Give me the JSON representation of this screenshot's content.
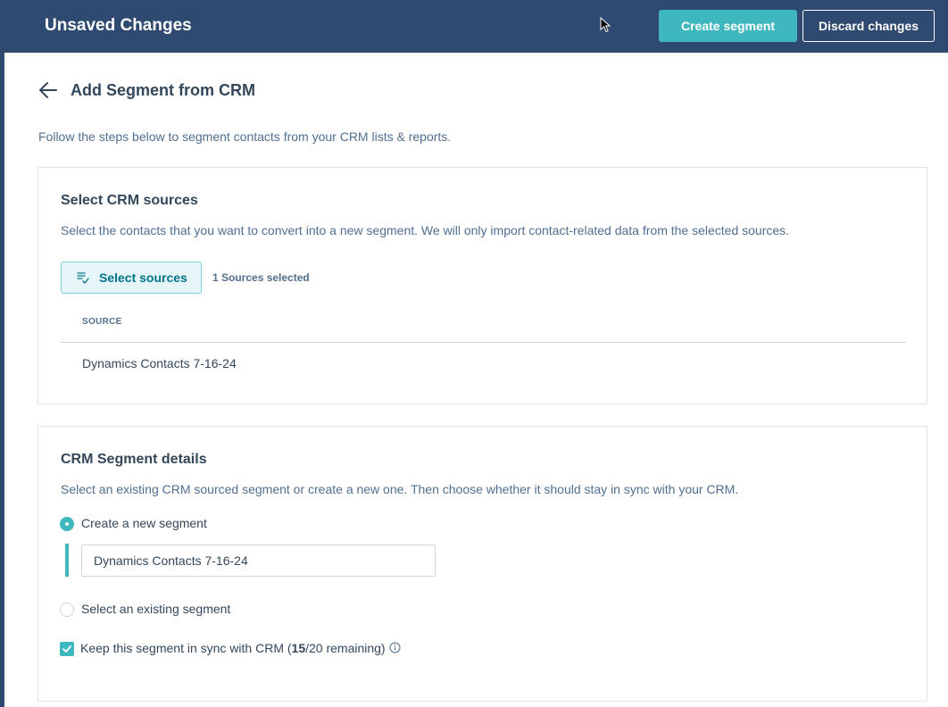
{
  "header": {
    "title": "Unsaved Changes",
    "create_label": "Create segment",
    "discard_label": "Discard changes"
  },
  "page": {
    "title": "Add Segment from CRM",
    "description": "Follow the steps below to segment contacts from your CRM lists & reports."
  },
  "sources_card": {
    "title": "Select CRM sources",
    "description": "Select the contacts that you want to convert into a new segment. We will only import contact-related data from the selected sources.",
    "select_button_label": "Select sources",
    "selected_count": "1 Sources selected",
    "column_header": "SOURCE",
    "rows": [
      "Dynamics Contacts 7-16-24"
    ]
  },
  "details_card": {
    "title": "CRM Segment details",
    "description": "Select an existing CRM sourced segment or create a new one. Then choose whether it should stay in sync with your CRM.",
    "option_new": "Create a new segment",
    "new_segment_value": "Dynamics Contacts 7-16-24",
    "option_existing": "Select an existing segment",
    "sync_prefix": "Keep this segment in sync with CRM (",
    "sync_used": "15",
    "sync_suffix": "/20 remaining)"
  },
  "colors": {
    "topbar": "#2e4a70",
    "accent": "#3fb7be",
    "text": "#33475b"
  },
  "icons": [
    "cursor-icon",
    "back-arrow-icon",
    "filter-list-icon",
    "checkmark-icon",
    "info-icon"
  ]
}
